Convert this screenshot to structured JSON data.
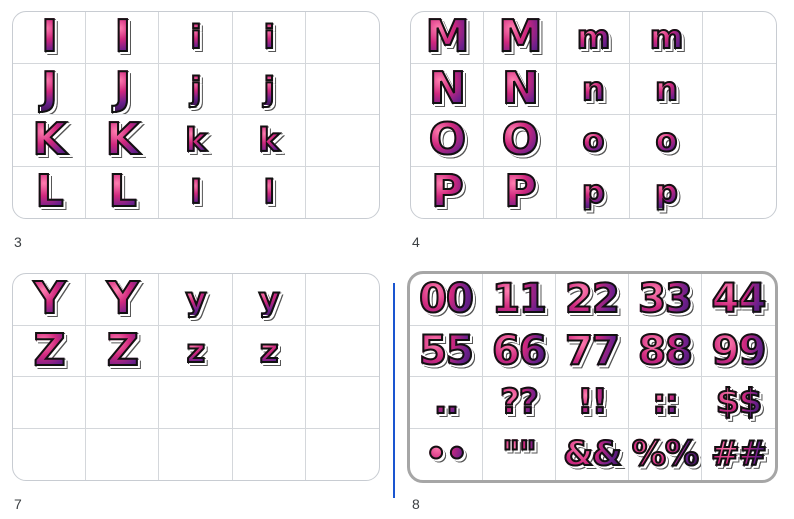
{
  "slides": [
    {
      "number": "3",
      "rows": [
        [
          "I",
          "I",
          "i",
          "i",
          ""
        ],
        [
          "J",
          "J",
          "j",
          "j",
          ""
        ],
        [
          "K",
          "K",
          "k",
          "k",
          ""
        ],
        [
          "L",
          "L",
          "l",
          "l",
          ""
        ]
      ]
    },
    {
      "number": "4",
      "rows": [
        [
          "M",
          "M",
          "m",
          "m",
          ""
        ],
        [
          "N",
          "N",
          "n",
          "n",
          ""
        ],
        [
          "O",
          "O",
          "o",
          "o",
          ""
        ],
        [
          "P",
          "P",
          "p",
          "p",
          ""
        ]
      ]
    },
    {
      "number": "7",
      "rows": [
        [
          "Y",
          "Y",
          "y",
          "y",
          ""
        ],
        [
          "Z",
          "Z",
          "z",
          "z",
          ""
        ],
        [
          "",
          "",
          "",
          "",
          ""
        ],
        [
          "",
          "",
          "",
          "",
          ""
        ]
      ]
    },
    {
      "number": "8",
      "selected": true,
      "rows": [
        [
          "00",
          "11",
          "22",
          "33",
          "44"
        ],
        [
          "55",
          "66",
          "77",
          "88",
          "99"
        ],
        [
          "..",
          "??",
          "!!",
          "::",
          "$$"
        ],
        [
          "••",
          "\"\"",
          "&&",
          "%%",
          "##"
        ]
      ]
    }
  ],
  "colors": {
    "accent": "#1a55d0",
    "glyph_fill": "#d0287e",
    "glyph_outline": "#111111",
    "slide_border": "#c8ccd2",
    "selected_border": "#a6a6a6"
  }
}
